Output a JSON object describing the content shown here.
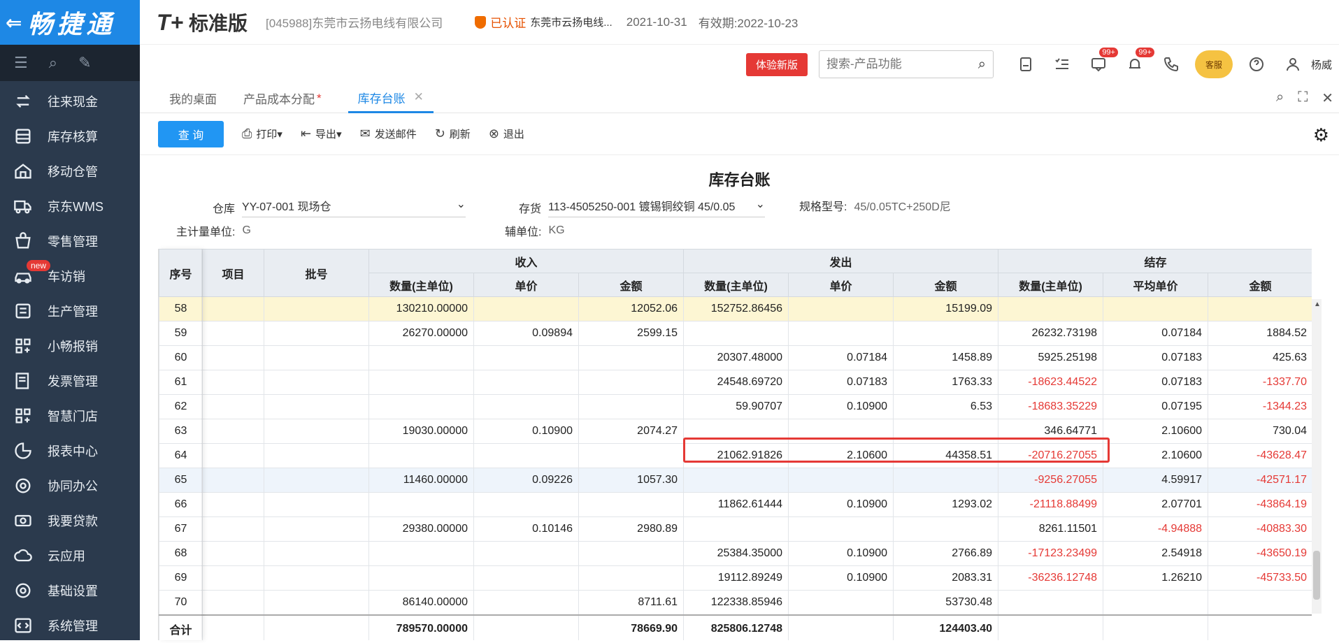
{
  "sidebar": {
    "logo_back": "⇐",
    "logo_text": "畅捷通",
    "items": [
      {
        "label": "往来现金",
        "icon": "transfer-icon"
      },
      {
        "label": "库存核算",
        "icon": "inventory-icon"
      },
      {
        "label": "移动仓管",
        "icon": "mobile-warehouse-icon"
      },
      {
        "label": "京东WMS",
        "icon": "truck-icon"
      },
      {
        "label": "零售管理",
        "icon": "retail-icon"
      },
      {
        "label": "车访销",
        "icon": "car-icon",
        "badge": "new"
      },
      {
        "label": "生产管理",
        "icon": "production-icon"
      },
      {
        "label": "小畅报销",
        "icon": "grid-icon"
      },
      {
        "label": "发票管理",
        "icon": "invoice-icon"
      },
      {
        "label": "智慧门店",
        "icon": "store-icon"
      },
      {
        "label": "报表中心",
        "icon": "pie-chart-icon"
      },
      {
        "label": "协同办公",
        "icon": "collab-icon"
      },
      {
        "label": "我要贷款",
        "icon": "money-icon"
      },
      {
        "label": "云应用",
        "icon": "cloud-icon"
      },
      {
        "label": "基础设置",
        "icon": "settings-icon"
      },
      {
        "label": "系统管理",
        "icon": "code-icon"
      }
    ]
  },
  "header": {
    "brand_t": "T+",
    "brand": "标准版",
    "company": "[045988]东莞市云扬电线有限公司",
    "cert_status": "已认证",
    "cert_name": "东莞市云扬电线...",
    "date": "2021-10-31",
    "expiry": "有效期:2022-10-23",
    "try_new": "体验新版",
    "search_placeholder": "搜索-产品功能",
    "msg_count": "99+",
    "notify_count": "99+",
    "service": "客服",
    "user": "杨威"
  },
  "tabs": [
    {
      "label": "我的桌面"
    },
    {
      "label": "产品成本分配",
      "star": "*"
    },
    {
      "label": "库存台账",
      "close": "✕"
    }
  ],
  "actions": {
    "query": "查 询",
    "print": "打印",
    "export": "导出",
    "email": "发送邮件",
    "refresh": "刷新",
    "exit": "退出"
  },
  "report": {
    "title": "库存台账",
    "warehouse_label": "仓库",
    "warehouse": "YY-07-001 现场仓",
    "item_label": "存货",
    "item": "113-4505250-001 镀锡铜绞铜 45/0.05",
    "spec_label": "规格型号:",
    "spec": "45/0.05TC+250D尼",
    "main_unit_label": "主计量单位:",
    "main_unit": "G",
    "aux_unit_label": "辅单位:",
    "aux_unit": "KG"
  },
  "table": {
    "headers": {
      "seq": "序号",
      "item": "项目",
      "batch": "批号",
      "in": "收入",
      "out": "发出",
      "balance": "结存",
      "qty": "数量(主单位)",
      "price": "单价",
      "amount": "金额",
      "avg_price": "平均单价"
    },
    "rows": [
      {
        "seq": "58",
        "in_qty": "130210.00000",
        "in_price": "",
        "in_amt": "12052.06",
        "out_qty": "152752.86456",
        "out_price": "",
        "out_amt": "15199.09",
        "bal_qty": "",
        "bal_price": "",
        "bal_amt": "",
        "style": "yellow"
      },
      {
        "seq": "59",
        "in_qty": "26270.00000",
        "in_price": "0.09894",
        "in_amt": "2599.15",
        "out_qty": "",
        "out_price": "",
        "out_amt": "",
        "bal_qty": "26232.73198",
        "bal_price": "0.07184",
        "bal_amt": "1884.52"
      },
      {
        "seq": "60",
        "in_qty": "",
        "in_price": "",
        "in_amt": "",
        "out_qty": "20307.48000",
        "out_price": "0.07184",
        "out_amt": "1458.89",
        "bal_qty": "5925.25198",
        "bal_price": "0.07183",
        "bal_amt": "425.63"
      },
      {
        "seq": "61",
        "in_qty": "",
        "in_price": "",
        "in_amt": "",
        "out_qty": "24548.69720",
        "out_price": "0.07183",
        "out_amt": "1763.33",
        "bal_qty": "-18623.44522",
        "bal_price": "0.07183",
        "bal_amt": "-1337.70"
      },
      {
        "seq": "62",
        "in_qty": "",
        "in_price": "",
        "in_amt": "",
        "out_qty": "59.90707",
        "out_price": "0.10900",
        "out_amt": "6.53",
        "bal_qty": "-18683.35229",
        "bal_price": "0.07195",
        "bal_amt": "-1344.23"
      },
      {
        "seq": "63",
        "in_qty": "19030.00000",
        "in_price": "0.10900",
        "in_amt": "2074.27",
        "out_qty": "",
        "out_price": "",
        "out_amt": "",
        "bal_qty": "346.64771",
        "bal_price": "2.10600",
        "bal_amt": "730.04"
      },
      {
        "seq": "64",
        "in_qty": "",
        "in_price": "",
        "in_amt": "",
        "out_qty": "21062.91826",
        "out_price": "2.10600",
        "out_amt": "44358.51",
        "bal_qty": "-20716.27055",
        "bal_price": "2.10600",
        "bal_amt": "-43628.47"
      },
      {
        "seq": "65",
        "in_qty": "11460.00000",
        "in_price": "0.09226",
        "in_amt": "1057.30",
        "out_qty": "",
        "out_price": "",
        "out_amt": "",
        "bal_qty": "-9256.27055",
        "bal_price": "4.59917",
        "bal_amt": "-42571.17",
        "style": "blue"
      },
      {
        "seq": "66",
        "in_qty": "",
        "in_price": "",
        "in_amt": "",
        "out_qty": "11862.61444",
        "out_price": "0.10900",
        "out_amt": "1293.02",
        "bal_qty": "-21118.88499",
        "bal_price": "2.07701",
        "bal_amt": "-43864.19"
      },
      {
        "seq": "67",
        "in_qty": "29380.00000",
        "in_price": "0.10146",
        "in_amt": "2980.89",
        "out_qty": "",
        "out_price": "",
        "out_amt": "",
        "bal_qty": "8261.11501",
        "bal_price": "-4.94888",
        "bal_amt": "-40883.30"
      },
      {
        "seq": "68",
        "in_qty": "",
        "in_price": "",
        "in_amt": "",
        "out_qty": "25384.35000",
        "out_price": "0.10900",
        "out_amt": "2766.89",
        "bal_qty": "-17123.23499",
        "bal_price": "2.54918",
        "bal_amt": "-43650.19"
      },
      {
        "seq": "69",
        "in_qty": "",
        "in_price": "",
        "in_amt": "",
        "out_qty": "19112.89249",
        "out_price": "0.10900",
        "out_amt": "2083.31",
        "bal_qty": "-36236.12748",
        "bal_price": "1.26210",
        "bal_amt": "-45733.50"
      },
      {
        "seq": "70",
        "in_qty": "86140.00000",
        "in_price": "",
        "in_amt": "8711.61",
        "out_qty": "122338.85946",
        "out_price": "",
        "out_amt": "53730.48",
        "bal_qty": "",
        "bal_price": "",
        "bal_amt": ""
      }
    ],
    "total": {
      "label": "合计",
      "in_qty": "789570.00000",
      "in_amt": "78669.90",
      "out_qty": "825806.12748",
      "out_amt": "124403.40"
    }
  },
  "colors": {
    "sidebar": "#2b3a4d",
    "brand_blue": "#1e88e5",
    "negative": "#e53935",
    "highlight_box": "#e53935"
  }
}
